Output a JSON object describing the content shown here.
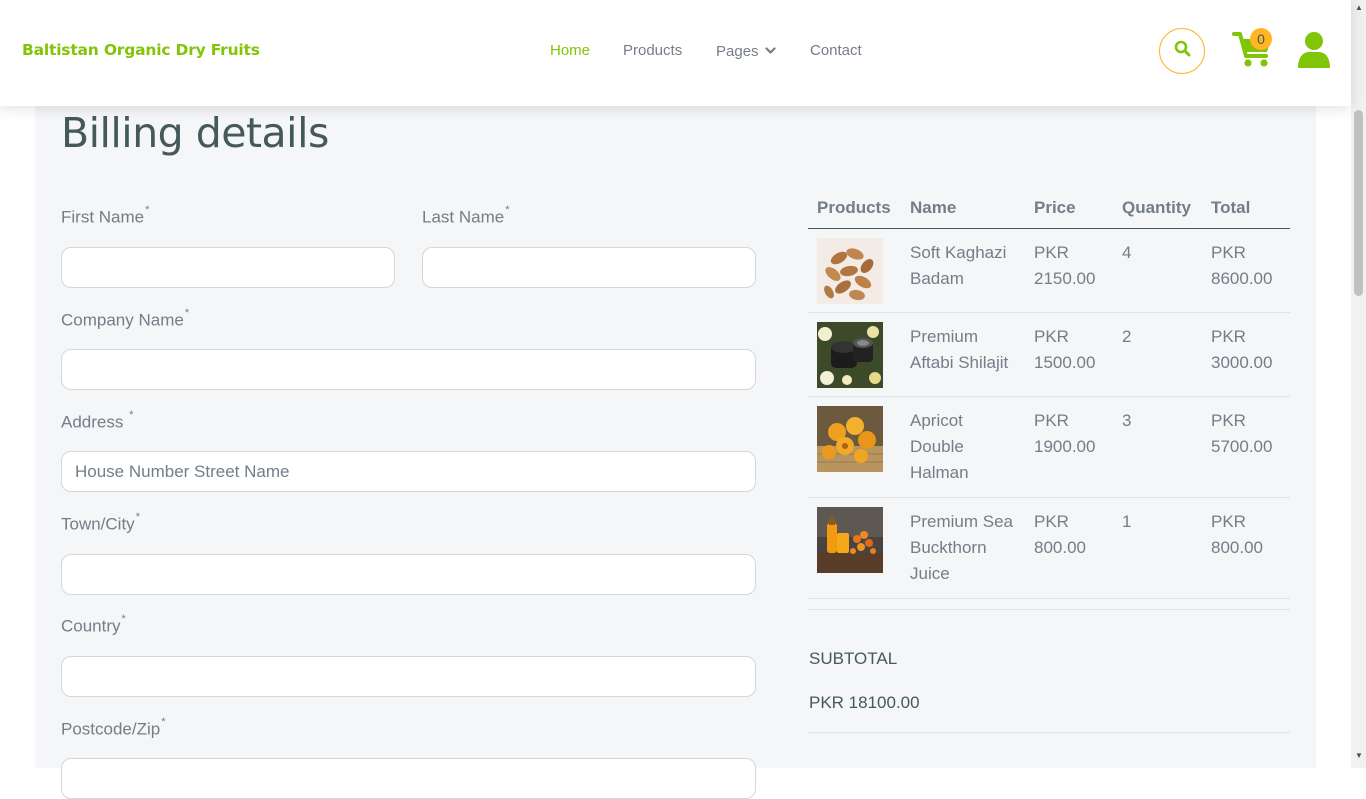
{
  "header": {
    "brand": "Baltistan Organic Dry Fruits",
    "nav": [
      {
        "label": "Home"
      },
      {
        "label": "Products"
      },
      {
        "label": "Pages"
      },
      {
        "label": "Contact"
      }
    ],
    "cart_count": "0",
    "icons": [
      "search-icon",
      "cart-icon",
      "user-icon",
      "chevron-down-icon"
    ]
  },
  "colors": {
    "brand_green": "#81c408",
    "accent_orange": "#ffb524",
    "heading": "#45595b",
    "text": "#747d88",
    "panel_bg": "#f4f6f8"
  },
  "billing": {
    "title": "Billing details",
    "first_name": {
      "label": "First Name",
      "required": "*",
      "value": ""
    },
    "last_name": {
      "label": "Last Name",
      "required": "*",
      "value": ""
    },
    "company": {
      "label": "Company Name",
      "required": "*",
      "value": ""
    },
    "address": {
      "label": "Address",
      "required": "*",
      "placeholder": "House Number Street Name"
    },
    "town": {
      "label": "Town/City",
      "required": "*",
      "value": ""
    },
    "country": {
      "label": "Country",
      "required": "*",
      "value": ""
    },
    "postcode": {
      "label": "Postcode/Zip",
      "required": "*",
      "value": ""
    }
  },
  "order": {
    "columns": [
      "Products",
      "Name",
      "Price",
      "Quantity",
      "Total"
    ],
    "rows": [
      {
        "image": "almond-thumbnail",
        "name": "Soft Kaghazi Badam",
        "price": "PKR 2150.00",
        "quantity": "4",
        "total": "PKR 8600.00"
      },
      {
        "image": "shilajit-thumbnail",
        "name": "Premium Aftabi Shilajit",
        "price": "PKR 1500.00",
        "quantity": "2",
        "total": "PKR 3000.00"
      },
      {
        "image": "apricot-thumbnail",
        "name": "Apricot Double Halman",
        "price": "PKR 1900.00",
        "quantity": "3",
        "total": "PKR 5700.00"
      },
      {
        "image": "juice-thumbnail",
        "name": "Premium Sea Buckthorn Juice",
        "price": "PKR 800.00",
        "quantity": "1",
        "total": "PKR 800.00"
      }
    ],
    "subtotal_label": "SUBTOTAL",
    "subtotal_value": "PKR 18100.00"
  }
}
